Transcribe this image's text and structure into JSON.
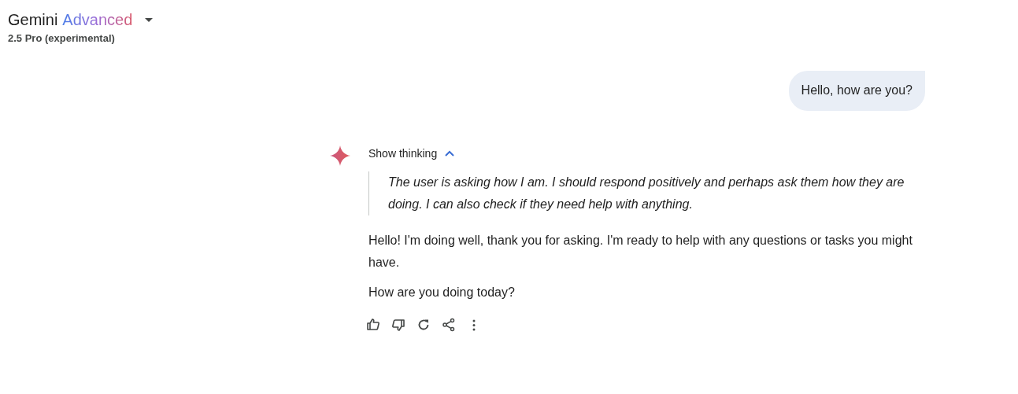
{
  "header": {
    "brand": "Gemini",
    "tier": "Advanced",
    "model": "2.5 Pro (experimental)"
  },
  "conversation": [
    {
      "kind": "user",
      "text": "Hello, how are you?"
    },
    {
      "kind": "model",
      "thinking": {
        "label": "Show thinking",
        "expanded": true,
        "text": "The user is asking how I am. I should respond positively and perhaps ask them how they are doing. I can also check if they need help with anything."
      },
      "paragraphs": [
        "Hello! I'm doing well, thank you for asking. I'm ready to help with any questions or tasks you might have.",
        "How are you doing today?"
      ]
    }
  ]
}
